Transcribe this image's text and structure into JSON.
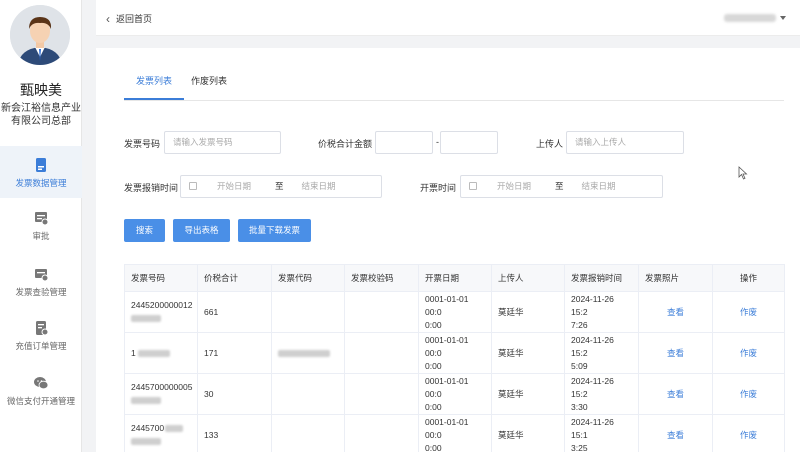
{
  "user": {
    "name": "甄映美",
    "company": "新会江裕信息产业有限公司总部"
  },
  "nav": [
    {
      "label": "发票数据管理",
      "icon": "document-icon",
      "active": true
    },
    {
      "label": "审批",
      "icon": "approval-icon"
    },
    {
      "label": "发票查验管理",
      "icon": "invoice-check-icon"
    },
    {
      "label": "充值订单管理",
      "icon": "recharge-order-icon"
    },
    {
      "label": "微信支付开通管理",
      "icon": "wechat-icon"
    }
  ],
  "topbar": {
    "back_label": "返回首页"
  },
  "tabs": [
    "发票列表",
    "作废列表"
  ],
  "filters": {
    "invoice_no_label": "发票号码",
    "invoice_no_placeholder": "请输入发票号码",
    "amount_label": "价税合计金额",
    "amount_sep": "-",
    "uploader_label": "上传人",
    "uploader_placeholder": "请输入上传人",
    "report_time_label": "发票报销时间",
    "open_time_label": "开票时间",
    "start_placeholder": "开始日期",
    "range_to": "至",
    "end_placeholder": "结束日期"
  },
  "buttons": {
    "search": "搜索",
    "export": "导出表格",
    "batch_download": "批量下载发票"
  },
  "table": {
    "headers": [
      "发票号码",
      "价税合计",
      "发票代码",
      "发票校验码",
      "开票日期",
      "上传人",
      "发票报销时间",
      "发票照片",
      "操作"
    ],
    "rows": [
      {
        "invoice_no_1": "2445200000012",
        "total": "661",
        "open_date_1": "0001-01-01 00:0",
        "open_date_2": "0:00",
        "uploader": "莫廷华",
        "report_1": "2024-11-26 15:2",
        "report_2": "7:26",
        "photo": "查看",
        "action": "作废"
      },
      {
        "invoice_no_1": "1",
        "total": "171",
        "open_date_1": "0001-01-01 00:0",
        "open_date_2": "0:00",
        "uploader": "莫廷华",
        "report_1": "2024-11-26 15:2",
        "report_2": "5:09",
        "photo": "查看",
        "action": "作废"
      },
      {
        "invoice_no_1": "2445700000005",
        "total": "30",
        "open_date_1": "0001-01-01 00:0",
        "open_date_2": "0:00",
        "uploader": "莫廷华",
        "report_1": "2024-11-26 15:2",
        "report_2": "3:30",
        "photo": "查看",
        "action": "作废"
      },
      {
        "invoice_no_1": "2445700",
        "total": "133",
        "open_date_1": "0001-01-01 00:0",
        "open_date_2": "0:00",
        "uploader": "莫廷华",
        "report_1": "2024-11-26 15:1",
        "report_2": "3:25",
        "photo": "查看",
        "action": "作废"
      }
    ]
  },
  "colors": {
    "accent": "#3b7dd8",
    "button": "#4a8fe7",
    "sidebar_active": "#eef3f9"
  }
}
